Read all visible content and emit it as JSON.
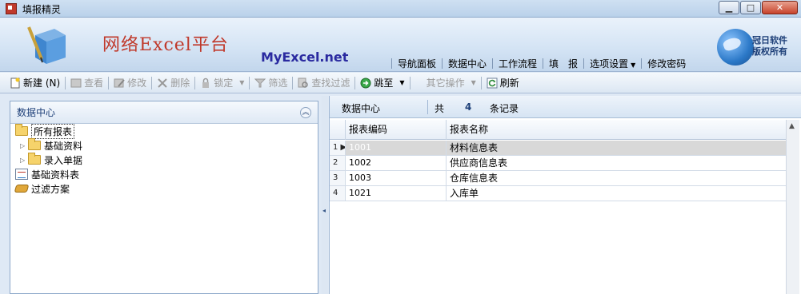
{
  "window": {
    "title": "填报精灵"
  },
  "banner": {
    "title": "网络Excel平台",
    "subtitle": "MyExcel.net",
    "copyright_line1": "冠日软件",
    "copyright_line2": "版权所有",
    "nav": [
      "导航面板",
      "数据中心",
      "工作流程",
      "填　报",
      "选项设置",
      "修改密码"
    ]
  },
  "toolbar": {
    "new": "新建 (N)",
    "view": "查看",
    "edit": "修改",
    "delete": "删除",
    "lock": "锁定",
    "filter": "筛选",
    "find_filter": "查找过滤",
    "jump": "跳至",
    "other": "其它操作",
    "refresh": "刷新"
  },
  "left_panel": {
    "title": "数据中心",
    "tree": {
      "root": "所有报表",
      "children": [
        "基础资料",
        "录入单据"
      ],
      "extra": [
        "基础资料表",
        "过滤方案"
      ]
    }
  },
  "right_panel": {
    "header_title": "数据中心",
    "count_prefix": "共",
    "count": "4",
    "count_suffix": "条记录",
    "columns": [
      "报表编码",
      "报表名称"
    ],
    "rows": [
      {
        "index": "1",
        "code": "1001",
        "name": "材料信息表"
      },
      {
        "index": "2",
        "code": "1002",
        "name": "供应商信息表"
      },
      {
        "index": "3",
        "code": "1003",
        "name": "仓库信息表"
      },
      {
        "index": "4",
        "code": "1021",
        "name": "入库单"
      }
    ]
  }
}
